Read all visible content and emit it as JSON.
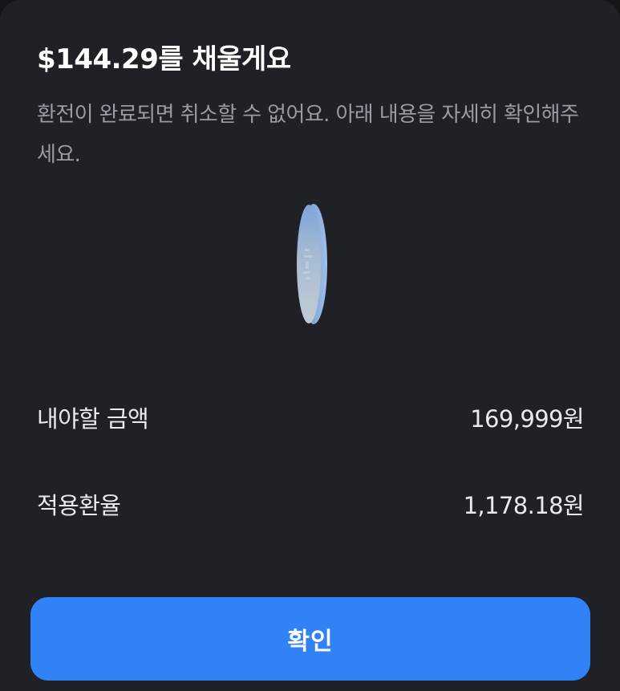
{
  "sheet": {
    "title": "$144.29를 채울게요",
    "description": "환전이 완료되면 취소할 수 없어요. 아래 내용을 자세히 확인해주세요.",
    "illustration_icon": "spinning-coin-icon",
    "rows": [
      {
        "label": "내야할 금액",
        "value": "169,999원"
      },
      {
        "label": "적용환율",
        "value": "1,178.18원"
      }
    ],
    "confirm_label": "확인"
  },
  "colors": {
    "background": "#202027",
    "title": "#ffffff",
    "description": "#9a9ba3",
    "row_text": "#e9e9ee",
    "accent": "#3182f6"
  }
}
